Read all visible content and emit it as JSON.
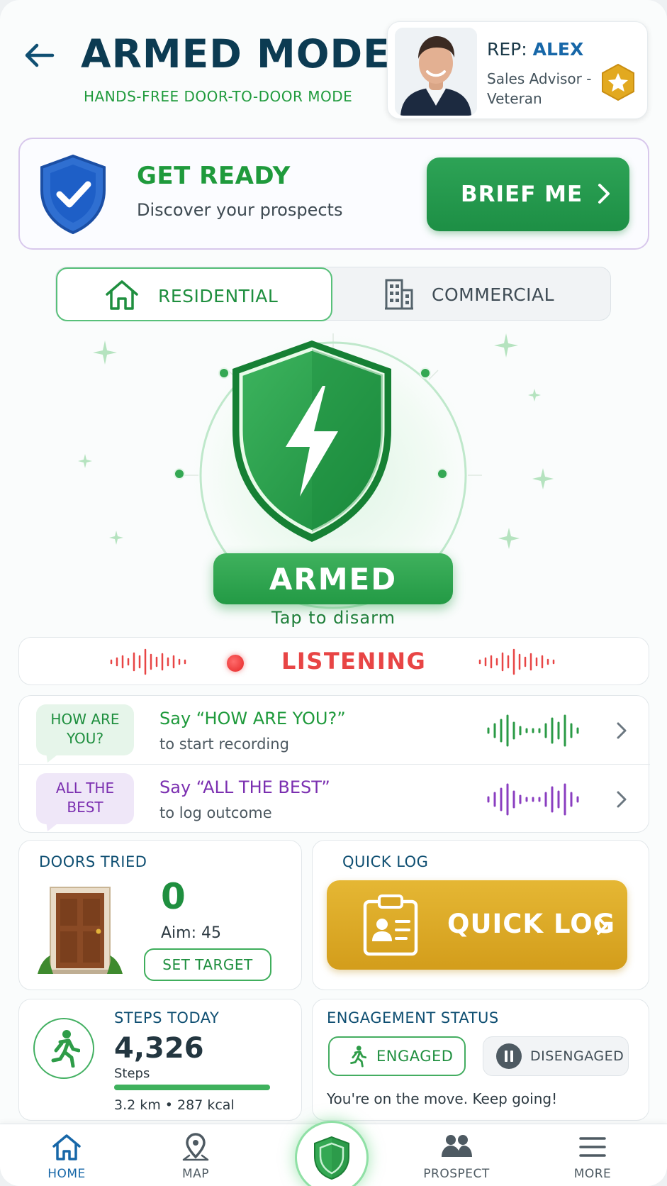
{
  "header": {
    "title": "ARMED MODE",
    "subtitle": "HANDS-FREE DOOR-TO-DOOR MODE",
    "back_icon": "arrow-left-icon"
  },
  "rep": {
    "prefix": "REP:",
    "name": "ALEX",
    "role": "Sales Advisor - Veteran",
    "badge_icon": "star-badge-icon"
  },
  "get_ready": {
    "title": "GET READY",
    "subtitle": "Discover your prospects",
    "button_label": "BRIEF ME"
  },
  "segments": {
    "residential": "RESIDENTIAL",
    "commercial": "COMMERCIAL",
    "selected": "residential"
  },
  "status": {
    "armed_label": "ARMED",
    "tap_hint": "Tap to disarm",
    "listening_label": "LISTENING"
  },
  "commands": [
    {
      "bubble": "HOW ARE YOU?",
      "title": "Say “HOW ARE YOU?”",
      "subtitle": "to start recording",
      "color": "#1f9a3c",
      "bubble_bg": "#e6f5ea"
    },
    {
      "bubble": "ALL THE BEST",
      "title": "Say “ALL THE BEST”",
      "subtitle": "to log outcome",
      "color": "#7b2fb0",
      "bubble_bg": "#efe7f8"
    }
  ],
  "doors": {
    "heading": "DOORS TRIED",
    "count": "0",
    "aim": "Aim: 45",
    "set_target_label": "SET TARGET"
  },
  "quick_log": {
    "heading": "QUICK LOG",
    "button_label": "QUICK LOG"
  },
  "steps": {
    "heading": "STEPS TODAY",
    "count": "4,326",
    "unit": "Steps",
    "meta": "3.2 km • 287 kcal",
    "progress": 1.0
  },
  "engagement": {
    "heading": "ENGAGEMENT STATUS",
    "engaged_label": "ENGAGED",
    "disengaged_label": "DISENGAGED",
    "selected": "engaged",
    "note": "You're on the move. Keep going!"
  },
  "nav": {
    "items": [
      {
        "label": "HOME",
        "icon": "home-icon",
        "active": true
      },
      {
        "label": "MAP",
        "icon": "map-pin-icon",
        "active": false
      },
      {
        "label": "PROSPECT",
        "icon": "people-icon",
        "active": false
      },
      {
        "label": "MORE",
        "icon": "menu-icon",
        "active": false
      }
    ],
    "center_icon": "shield-icon"
  },
  "colors": {
    "primary_green": "#1f9a3c",
    "navy": "#0c3b52",
    "listening_red": "#e84545",
    "gold": "#d9a624",
    "purple": "#7b2fb0"
  }
}
